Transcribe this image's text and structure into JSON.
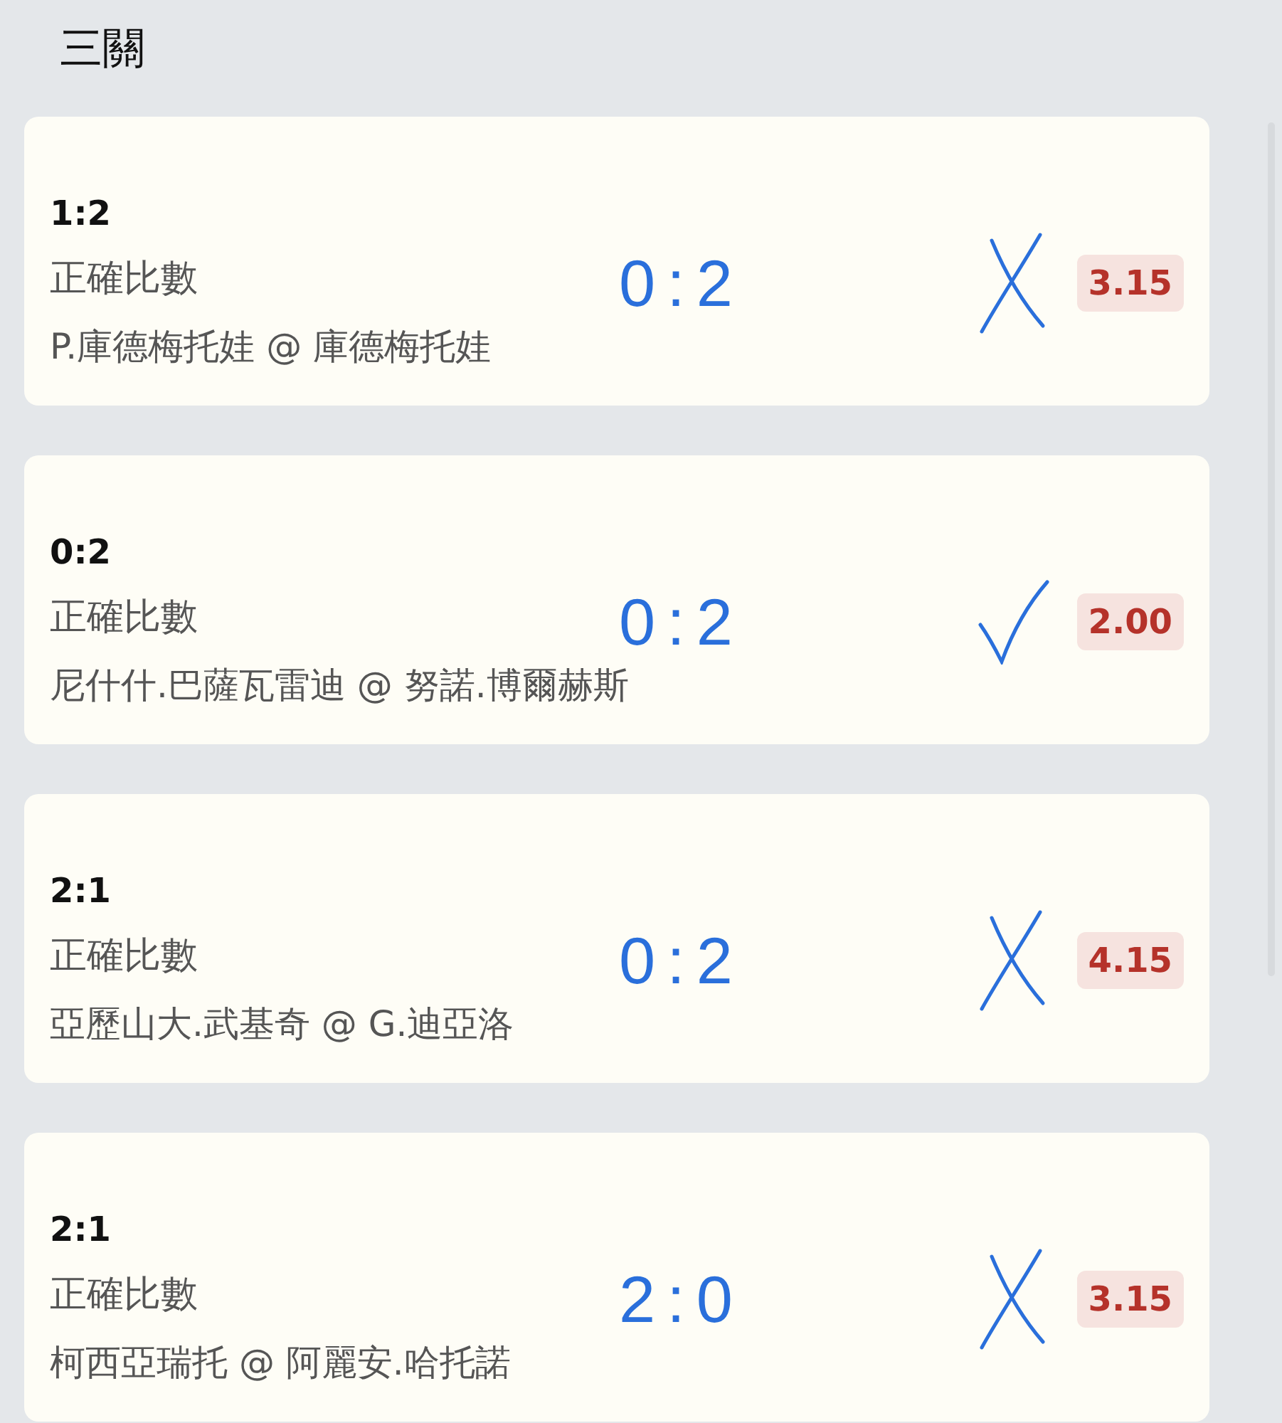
{
  "title": "三關",
  "bets": [
    {
      "score": "1:2",
      "market": "正確比數",
      "match": "P.庫德梅托娃 @ 庫德梅托娃",
      "annotation": "0:2",
      "kind": "cross",
      "odds": "3.15"
    },
    {
      "score": "0:2",
      "market": "正確比數",
      "match": "尼什什.巴薩瓦雷迪 @ 努諾.博爾赫斯",
      "annotation": "0:2",
      "kind": "check",
      "odds": "2.00"
    },
    {
      "score": "2:1",
      "market": "正確比數",
      "match": "亞歷山大.武基奇 @ G.迪亞洛",
      "annotation": "0:2",
      "kind": "cross",
      "odds": "4.15"
    },
    {
      "score": "2:1",
      "market": "正確比數",
      "match": "柯西亞瑞托 @ 阿麗安.哈托諾",
      "annotation": "2:0",
      "kind": "cross",
      "odds": "3.15"
    }
  ]
}
